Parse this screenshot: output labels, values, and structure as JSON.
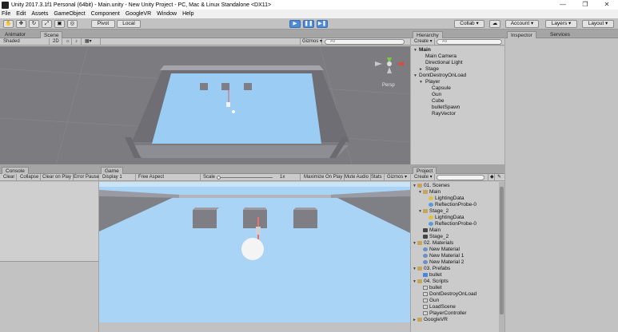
{
  "window": {
    "title": "Unity 2017.3.1f1 Personal (64bit) - Main.unity - New Unity Project - PC, Mac & Linux Standalone <DX11>",
    "minimize": "—",
    "maximize": "❐",
    "close": "✕"
  },
  "menu": [
    "File",
    "Edit",
    "Assets",
    "GameObject",
    "Component",
    "GoogleVR",
    "Window",
    "Help"
  ],
  "toolbar": {
    "pivot": "Pivot",
    "local": "Local",
    "collab": "Collab ▾",
    "account": "Account ▾",
    "layers": "Layers ▾",
    "layout": "Layout ▾"
  },
  "scene_panel": {
    "tabs": [
      "Animator",
      "Scene"
    ],
    "shading": "Shaded",
    "mode_2d": "2D",
    "gizmos": "Gizmos ▾",
    "search": "All",
    "persp": "Persp"
  },
  "console_panel": {
    "tab": "Console",
    "buttons": [
      "Clear",
      "Collapse",
      "Clear on Play",
      "Error Pause"
    ]
  },
  "game_panel": {
    "tab": "Game",
    "display": "Display 1",
    "aspect": "Free Aspect",
    "scale_label": "Scale",
    "scale_value": "1x",
    "buttons": [
      "Maximize On Play",
      "Mute Audio",
      "Stats",
      "Gizmos ▾"
    ]
  },
  "hierarchy": {
    "tab": "Hierarchy",
    "create": "Create ▾",
    "search": "All",
    "items": [
      {
        "label": "Main",
        "depth": 0,
        "bold": true,
        "arrow": "▼"
      },
      {
        "label": "Main Camera",
        "depth": 1,
        "bold": false,
        "arrow": ""
      },
      {
        "label": "Directional Light",
        "depth": 1,
        "bold": false,
        "arrow": ""
      },
      {
        "label": "Stage",
        "depth": 1,
        "bold": false,
        "arrow": "►"
      },
      {
        "label": "DontDestroyOnLoad",
        "depth": 0,
        "bold": false,
        "arrow": "▼"
      },
      {
        "label": "Player",
        "depth": 1,
        "bold": false,
        "arrow": "▼"
      },
      {
        "label": "Capsule",
        "depth": 2,
        "bold": false,
        "arrow": ""
      },
      {
        "label": "Gun",
        "depth": 2,
        "bold": false,
        "arrow": ""
      },
      {
        "label": "Cube",
        "depth": 2,
        "bold": false,
        "arrow": ""
      },
      {
        "label": "bulletSpawn",
        "depth": 2,
        "bold": false,
        "arrow": ""
      },
      {
        "label": "RayVector",
        "depth": 2,
        "bold": false,
        "arrow": ""
      }
    ]
  },
  "inspector": {
    "tabs": [
      "Inspector",
      "Services"
    ]
  },
  "project": {
    "tab": "Project",
    "create": "Create ▾",
    "items": [
      {
        "label": "01. Scenes",
        "depth": 0,
        "icon": "folder",
        "arrow": "▼"
      },
      {
        "label": "Main",
        "depth": 1,
        "icon": "folder",
        "arrow": "▼"
      },
      {
        "label": "LightingData",
        "depth": 2,
        "icon": "light",
        "arrow": ""
      },
      {
        "label": "ReflectionProbe-0",
        "depth": 2,
        "icon": "probe",
        "arrow": ""
      },
      {
        "label": "Stage_2",
        "depth": 1,
        "icon": "folder",
        "arrow": "▼"
      },
      {
        "label": "LightingData",
        "depth": 2,
        "icon": "light",
        "arrow": ""
      },
      {
        "label": "ReflectionProbe-0",
        "depth": 2,
        "icon": "probe",
        "arrow": ""
      },
      {
        "label": "Main",
        "depth": 1,
        "icon": "scene",
        "arrow": ""
      },
      {
        "label": "Stage_2",
        "depth": 1,
        "icon": "scene",
        "arrow": ""
      },
      {
        "label": "02. Materials",
        "depth": 0,
        "icon": "folder",
        "arrow": "▼"
      },
      {
        "label": "New Material",
        "depth": 1,
        "icon": "mat",
        "arrow": ""
      },
      {
        "label": "New Material 1",
        "depth": 1,
        "icon": "mat",
        "arrow": ""
      },
      {
        "label": "New Material 2",
        "depth": 1,
        "icon": "mat",
        "arrow": ""
      },
      {
        "label": "03. Prefabs",
        "depth": 0,
        "icon": "folder",
        "arrow": "▼"
      },
      {
        "label": "bullet",
        "depth": 1,
        "icon": "prefab",
        "arrow": ""
      },
      {
        "label": "04. Scripts",
        "depth": 0,
        "icon": "folder",
        "arrow": "▼"
      },
      {
        "label": "bullet",
        "depth": 1,
        "icon": "script",
        "arrow": ""
      },
      {
        "label": "DontDestroyOnLoad",
        "depth": 1,
        "icon": "script",
        "arrow": ""
      },
      {
        "label": "Gun",
        "depth": 1,
        "icon": "script",
        "arrow": ""
      },
      {
        "label": "LoadScene",
        "depth": 1,
        "icon": "script",
        "arrow": ""
      },
      {
        "label": "PlayerController",
        "depth": 1,
        "icon": "script",
        "arrow": ""
      },
      {
        "label": "GoogleVR",
        "depth": 0,
        "icon": "folder",
        "arrow": "►"
      }
    ]
  },
  "colors": {
    "accent": "#4d8ad8",
    "floor": "#a9d4f5",
    "wall": "#8e8e96",
    "sky": "#b9d9f2"
  }
}
